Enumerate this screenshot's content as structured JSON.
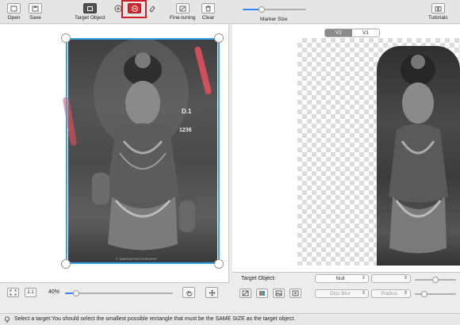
{
  "toolbar": {
    "open": "Open",
    "save": "Save",
    "target_object": "Target Object",
    "fine_tuning": "Fine-tuning",
    "clear": "Clear",
    "marker_size": "Marker Size",
    "marker_size_level": 0.3,
    "tutorials": "Tutorials"
  },
  "left_canvas": {
    "image_text_1": "D.1",
    "image_text_2": "1236",
    "credit": "© JAMSHA PHOTOGRAPHY"
  },
  "left_bottom": {
    "one_to_one": "1:1",
    "zoom": "40%",
    "zoom_level": 0.1
  },
  "right_panel": {
    "version_tabs": [
      "V2",
      "V1"
    ],
    "active_version": "V2"
  },
  "right_bottom": {
    "target_object_label": "Target Object:",
    "target_object_value": "Null",
    "blur_value": "Disc Blur",
    "radius_value": "Radius"
  },
  "status": {
    "message": "Select a target:You should select the smallest possible rectangle that must be the SAME SIZE as the target object."
  },
  "colors": {
    "accent": "#3b82f6",
    "selection": "#34a6e8",
    "highlight": "#d01c24",
    "marker": "#e8505b"
  }
}
